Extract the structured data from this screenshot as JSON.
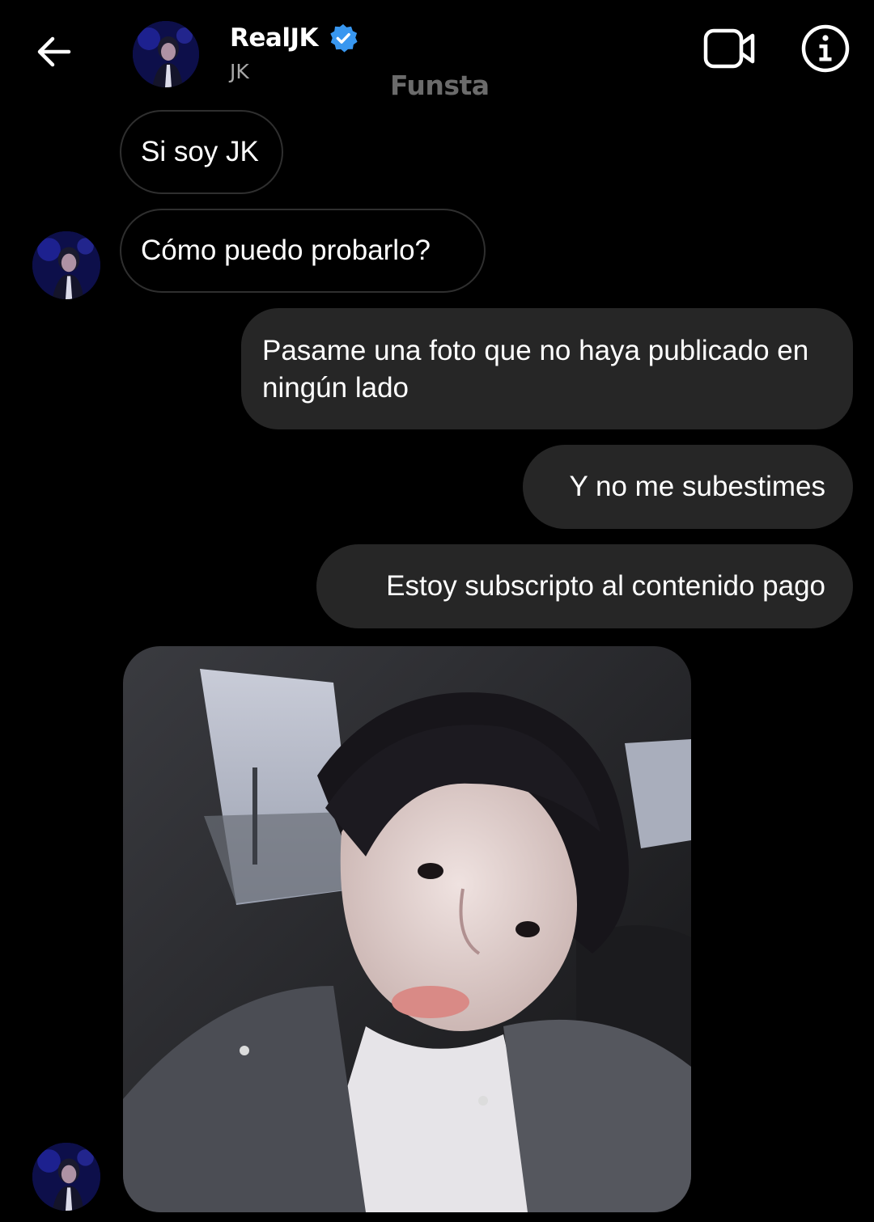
{
  "header": {
    "back_icon": "arrow-left-icon",
    "name": "RealJK",
    "verified_icon": "verified-badge-icon",
    "verified_color": "#3897f0",
    "handle": "JK",
    "watermark": "Funsta",
    "video_call_icon": "video-camera-icon",
    "info_icon": "info-circle-icon"
  },
  "messages": [
    {
      "from": "them",
      "text": "Si soy JK"
    },
    {
      "from": "them",
      "text": "Cómo puedo probarlo?"
    },
    {
      "from": "me",
      "text": "Pasame una foto que no haya publicado en ningún lado"
    },
    {
      "from": "me",
      "text": "Y no me subestimes"
    },
    {
      "from": "me",
      "text": "Estoy subscripto al contenido pago"
    },
    {
      "from": "them",
      "type": "photo"
    }
  ],
  "colors": {
    "background": "#000000",
    "sent_bubble": "#262626",
    "received_border": "#2f2f2f",
    "secondary_text": "#a8a8a8"
  }
}
